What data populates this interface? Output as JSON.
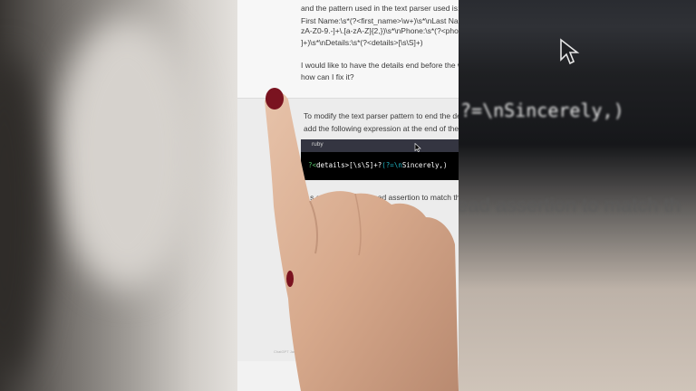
{
  "user_message": {
    "lines": [
      "and the pattern used in the text parser used is:",
      "First Name:\\s*(?<first_name>\\w+)\\s*\\nLast Nam",
      "zA-Z0-9.-]+\\.[a-zA-Z]{2,})\\s*\\nPhone:\\s*(?<pho",
      "]+)\\s*\\nDetails:\\s*(?<details>[\\s\\S]+)",
      "I would like to have the details end before the wo",
      "how can I fix it?"
    ]
  },
  "assistant_message": {
    "lines": [
      "To modify the text parser pattern to end the detail",
      "add the following expression at the end of the patte"
    ],
    "code_language": "ruby",
    "code": {
      "part1": "?<",
      "part2": "details>[\\s\\S]+?",
      "part3": "(?=\\n",
      "part4": "Sincerely,)"
    },
    "after_line": "...s a positive lookahead assertion to match th"
  },
  "side_right_text": {
    "top": "?=\\nSincerely,)",
    "mid": "ead assertion to match th"
  },
  "footer": "ChatGPT Jan 30 Version"
}
